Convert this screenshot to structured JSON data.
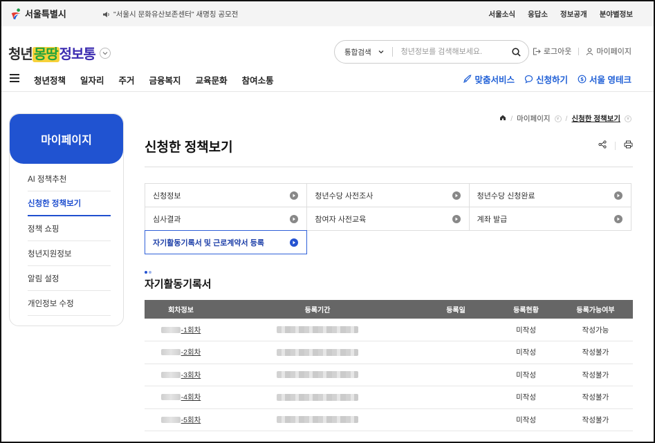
{
  "utility": {
    "logo_text": "서울특별시",
    "notice": "\"서울시 문화유산보존센터\" 새명칭 공모전",
    "links": [
      "서울소식",
      "응답소",
      "정보공개",
      "분야별정보"
    ]
  },
  "header": {
    "brand": {
      "part1": "청년",
      "part2": "몽땅",
      "part3": "정보통"
    },
    "search": {
      "scope": "통합검색",
      "placeholder": "청년정보를 검색해보세요."
    },
    "account": {
      "logout": "로그아웃",
      "mypage": "마이페이지"
    }
  },
  "gnb": {
    "menu": [
      "청년정책",
      "일자리",
      "주거",
      "금융복지",
      "교육문화",
      "참여소통"
    ],
    "quick": [
      "맞춤서비스",
      "신청하기",
      "서울 영테크"
    ]
  },
  "sidebar": {
    "title": "마이페이지",
    "items": [
      {
        "label": "AI 정책추천",
        "active": false
      },
      {
        "label": "신청한 정책보기",
        "active": true
      },
      {
        "label": "정책 쇼핑",
        "active": false
      },
      {
        "label": "청년지원정보",
        "active": false
      },
      {
        "label": "알림 설정",
        "active": false
      },
      {
        "label": "개인정보 수정",
        "active": false
      }
    ]
  },
  "breadcrumb": {
    "level1": "마이페이지",
    "current": "신청한 정책보기"
  },
  "page_title": "신청한 정책보기",
  "subnav": {
    "rows": [
      [
        "신청정보",
        "청년수당 사전조사",
        "청년수당 신청완료"
      ],
      [
        "심사결과",
        "참여자 사전교육",
        "계좌 발급"
      ],
      [
        "자기활동기록서 및 근로계약서 등록"
      ]
    ],
    "active": "자기활동기록서 및 근로계약서 등록"
  },
  "section": {
    "title": "자기활동기록서",
    "dot_colors": [
      "#2553d1",
      "#9fb4ea"
    ]
  },
  "table": {
    "headers": [
      "회차정보",
      "등록기간",
      "등록일",
      "등록현황",
      "등록가능여부"
    ],
    "rows": [
      {
        "round": "-1회차",
        "date": "",
        "status": "미작성",
        "availability": "작성가능"
      },
      {
        "round": "-2회차",
        "date": "",
        "status": "미작성",
        "availability": "작성불가"
      },
      {
        "round": "-3회차",
        "date": "",
        "status": "미작성",
        "availability": "작성불가"
      },
      {
        "round": "-4회차",
        "date": "",
        "status": "미작성",
        "availability": "작성불가"
      },
      {
        "round": "-5회차",
        "date": "",
        "status": "미작성",
        "availability": "작성불가"
      }
    ]
  },
  "colors": {
    "primary": "#2053d1",
    "link": "#2b5fc9",
    "table_header": "#666666"
  },
  "icons": {
    "logo": "seoul-logo-icon",
    "notice": "speaker-icon",
    "search": "search-icon",
    "logout": "logout-icon",
    "mypage": "user-icon",
    "menu": "hamburger-icon",
    "quick": [
      "rocket-icon",
      "chat-icon",
      "coin-icon"
    ],
    "home": "home-icon",
    "share": "share-icon",
    "print": "print-icon",
    "arrow": "arrow-circle-icon"
  }
}
